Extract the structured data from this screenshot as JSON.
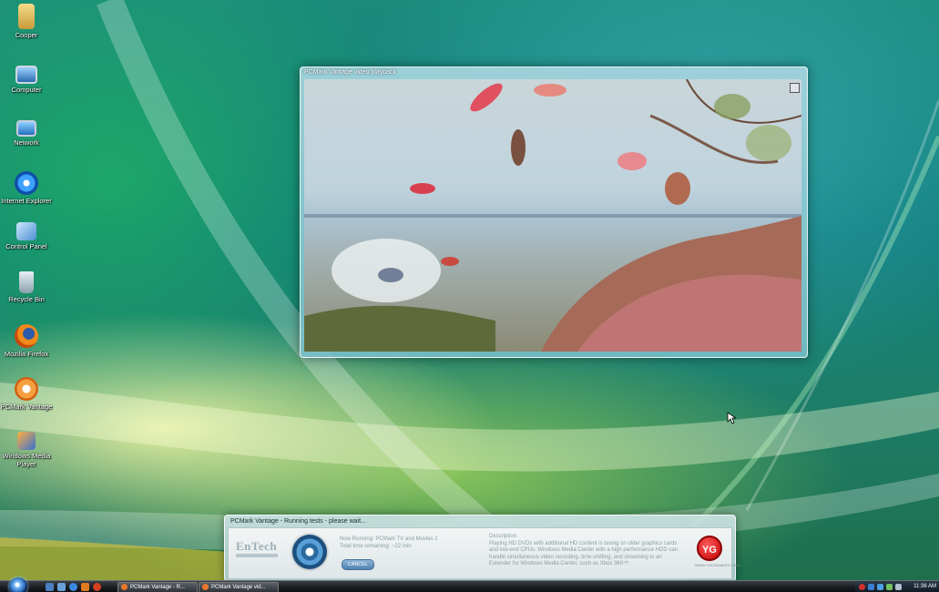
{
  "desktop": {
    "icons": [
      {
        "label": "Cooper",
        "icon": "folder-icon"
      },
      {
        "label": "Computer",
        "icon": "computer-icon"
      },
      {
        "label": "Network",
        "icon": "network-icon"
      },
      {
        "label": "Internet Explorer",
        "icon": "internet-explorer-icon"
      },
      {
        "label": "Control Panel",
        "icon": "control-panel-icon"
      },
      {
        "label": "Recycle Bin",
        "icon": "recycle-bin-icon"
      },
      {
        "label": "Mozilla Firefox",
        "icon": "firefox-icon"
      },
      {
        "label": "PCMark Vantage",
        "icon": "pcmark-icon"
      },
      {
        "label": "Windows Media Player",
        "icon": "media-player-icon"
      }
    ]
  },
  "video_window": {
    "title": "PCMark Vantage video playback"
  },
  "dialog": {
    "title": "PCMark Vantage - Running tests - please wait...",
    "brand": "EnTech",
    "status_line1": "Now Running: PCMark TV and Movies 2",
    "status_line2": "Total time remaining: ~22 min",
    "cancel_label": "CANCEL",
    "description_heading": "Description",
    "description": "Playing HD DVDs with additional HD content is taxing on older graphics cards and low-end CPUs. Windows Media Center with a high performance HDD can handle simultaneous video recording, time-shifting, and streaming to an Extender for Windows Media Center, such as Xbox 360™.",
    "logo_text": "YG",
    "logo_site": "WWW.YOUGAMERS.COM"
  },
  "taskbar": {
    "buttons": [
      {
        "label": "PCMark Vantage - R..."
      },
      {
        "label": "PCMark Vantage vid..."
      }
    ],
    "clock": "11:36 AM"
  },
  "colors": {
    "taskbar": "#1b1e22",
    "accent_blue": "#1e5aa8",
    "yg_red": "#c20000"
  }
}
